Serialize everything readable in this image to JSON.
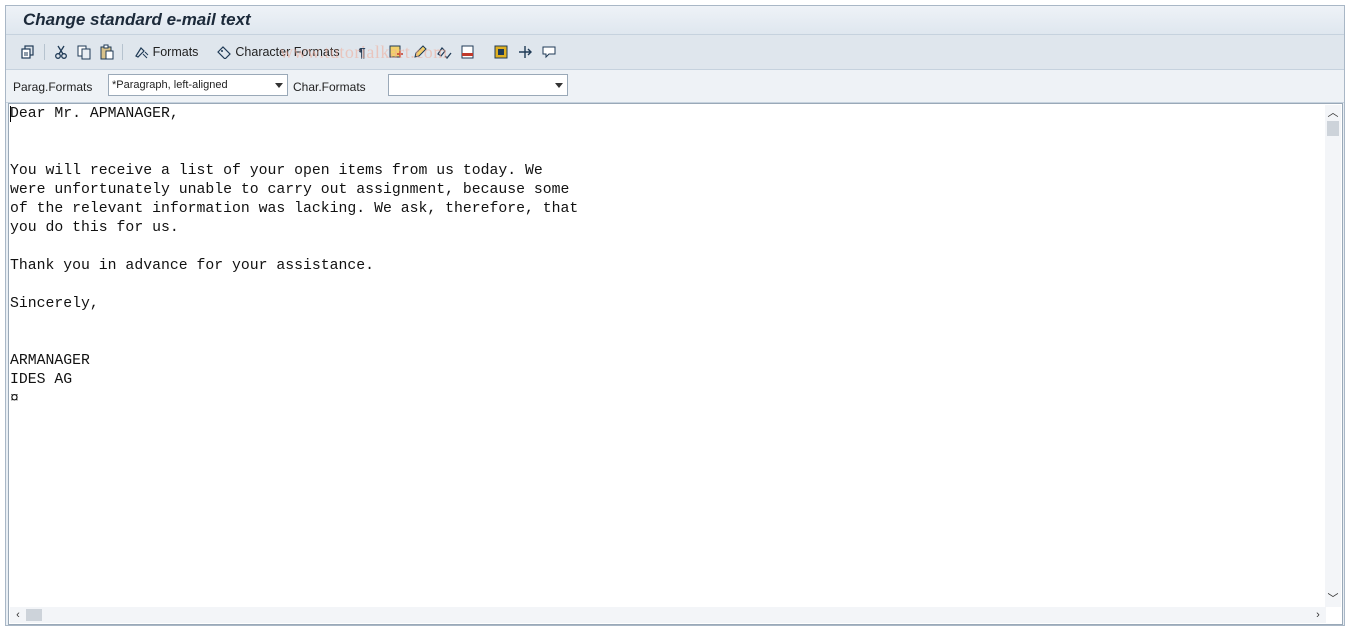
{
  "window": {
    "title": "Change standard e-mail text"
  },
  "toolbar": {
    "formats_label": "Formats",
    "character_formats_label": "Character Formats",
    "watermark": "www.tutorialkart.com"
  },
  "formatbar": {
    "parag_label": "Parag.Formats",
    "parag_value": "*Paragraph, left-aligned",
    "char_label": "Char.Formats",
    "char_value": ""
  },
  "editor": {
    "lines": [
      "Dear Mr. APMANAGER,",
      "",
      "",
      "You will receive a list of your open items from us today. We",
      "were unfortunately unable to carry out assignment, because some",
      "of the relevant information was lacking. We ask, therefore, that",
      "you do this for us.",
      "",
      "Thank you in advance for your assistance.",
      "",
      "Sincerely,",
      "",
      "",
      "ARMANAGER",
      "IDES AG",
      "¤"
    ]
  },
  "colors": {
    "title_bar": "#dfe7ef",
    "toolbar": "#dfe6ed",
    "icon_blue": "#1f3a56",
    "accent_red": "#c0392b",
    "accent_yellow": "#e0b020"
  }
}
